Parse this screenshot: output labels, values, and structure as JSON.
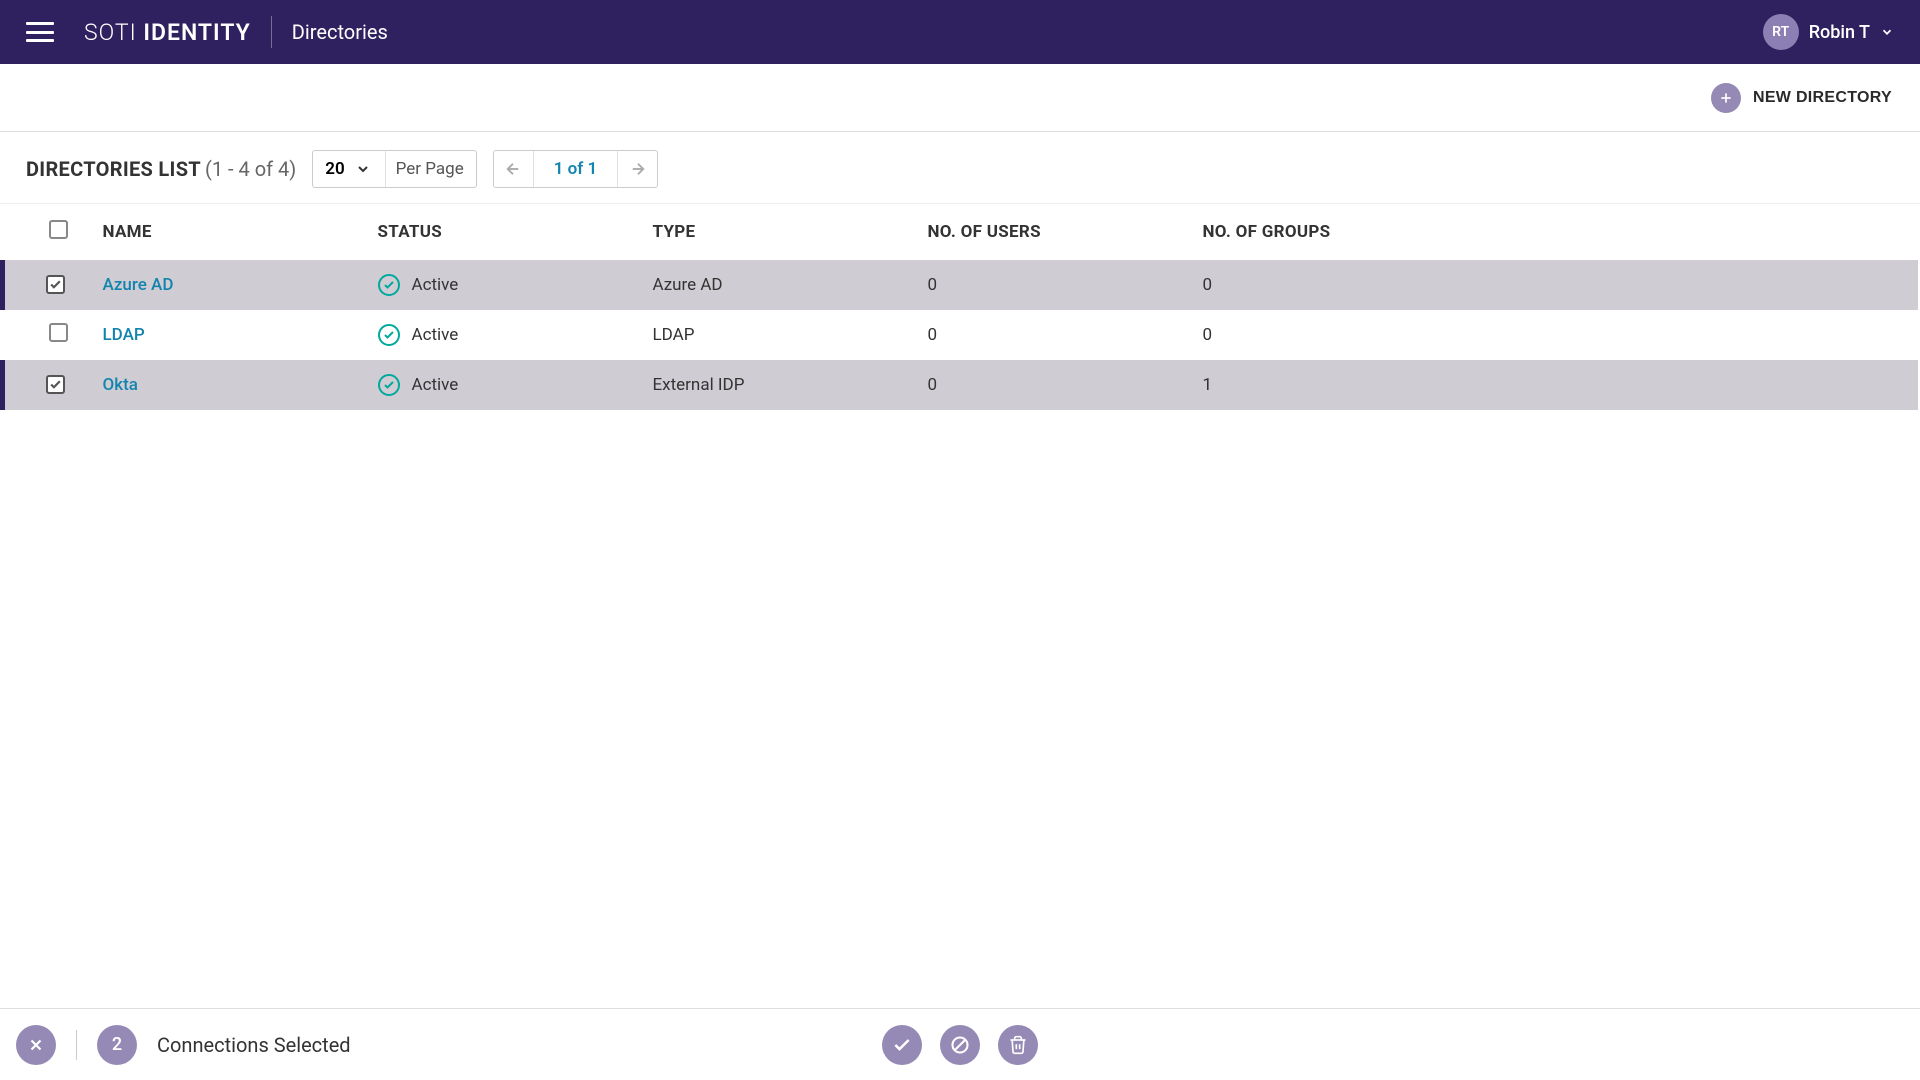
{
  "header": {
    "logo_part1": "SOTI ",
    "logo_part2": "IDENTITY",
    "page_title": "Directories",
    "user_initials": "RT",
    "user_name": "Robin T"
  },
  "action": {
    "new_directory_label": "NEW DIRECTORY"
  },
  "toolbar": {
    "list_title": "DIRECTORIES LIST",
    "range_label": "(1 - 4 of 4)",
    "page_size": "20",
    "per_page_label": "Per Page",
    "pager_label": "1 of 1"
  },
  "columns": {
    "name": "NAME",
    "status": "STATUS",
    "type": "TYPE",
    "users": "NO. OF USERS",
    "groups": "NO. OF GROUPS"
  },
  "rows": [
    {
      "name": "Azure AD",
      "status": "Active",
      "type": "Azure AD",
      "users": "0",
      "groups": "0",
      "selected": true
    },
    {
      "name": "LDAP",
      "status": "Active",
      "type": "LDAP",
      "users": "0",
      "groups": "0",
      "selected": false
    },
    {
      "name": "Okta",
      "status": "Active",
      "type": "External IDP",
      "users": "0",
      "groups": "1",
      "selected": true
    }
  ],
  "selection": {
    "count": "2",
    "label": "Connections Selected"
  }
}
